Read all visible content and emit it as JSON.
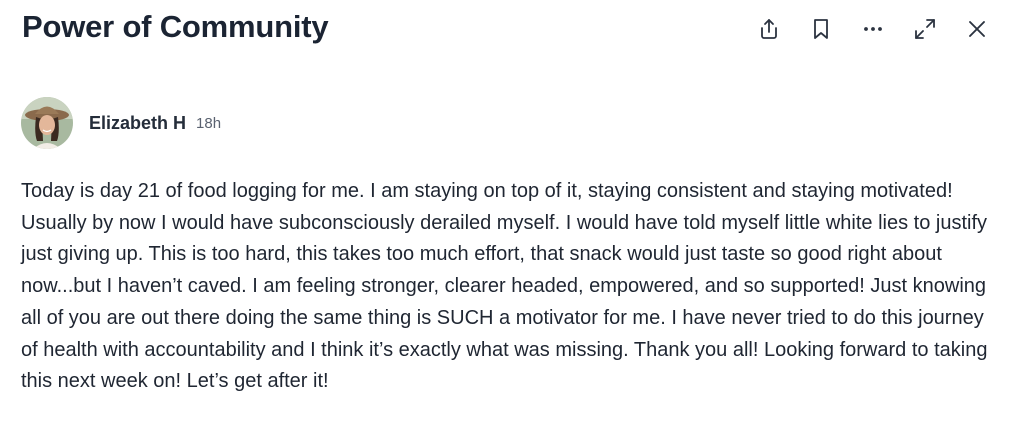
{
  "post": {
    "title": "Power of Community",
    "author_name": "Elizabeth H",
    "timestamp": "18h",
    "body": "Today is day 21 of food logging for me. I am staying on top of it, staying consistent and staying motivated! Usually by now I would have subconsciously derailed myself. I would have told myself little white lies to justify just giving up. This is too hard, this takes too much effort, that snack would just taste so good right about now...but I haven’t caved. I am feeling stronger, clearer headed, empowered, and so supported! Just knowing all of you are out there doing the same thing is SUCH a motivator for me. I have never tried to do this journey of health with accountability and I think it’s exactly what was missing. Thank you all! Looking forward to taking this next week on! Let’s get after it!"
  },
  "toolbar": {
    "icons": [
      "share-icon",
      "bookmark-icon",
      "more-icon",
      "expand-icon",
      "close-icon"
    ]
  },
  "colors": {
    "text": "#1f2632",
    "icon": "#2b3340",
    "muted": "#5a6270",
    "background": "#ffffff"
  }
}
